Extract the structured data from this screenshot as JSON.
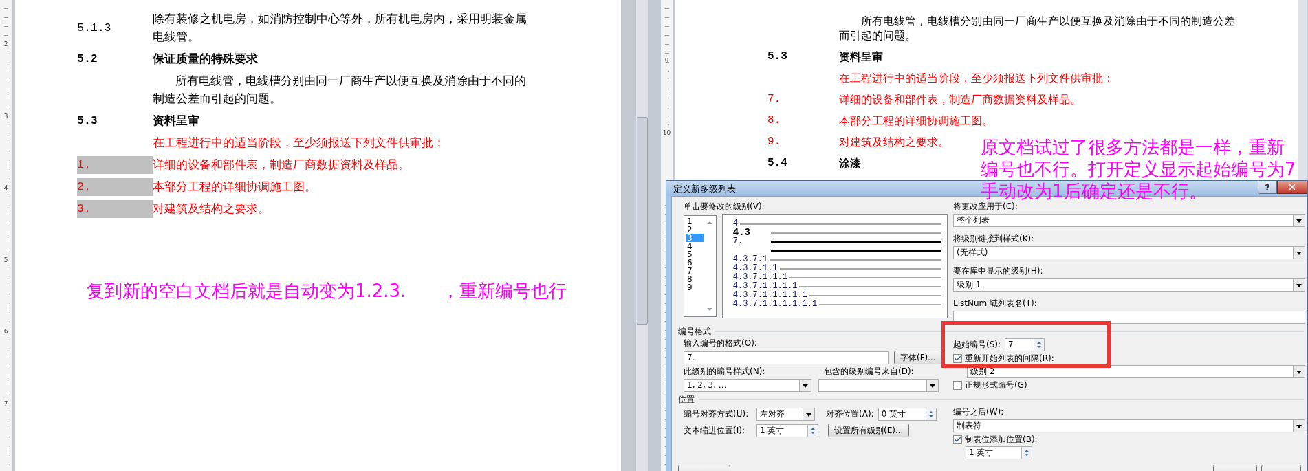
{
  "left_document": {
    "ruler": [
      "2",
      "3",
      "4",
      "5",
      "6",
      "7"
    ],
    "blocks": [
      {
        "kind": "clause",
        "number": "5.1.3",
        "text": "除有装修之机电房，如消防控制中心等外，所有机电房内，采用明装金属电线管。"
      },
      {
        "kind": "heading",
        "number": "5.2",
        "text": "保证质量的特殊要求"
      },
      {
        "kind": "paragraph",
        "text": "所有电线管，电线槽分别由同一厂商生产以便互换及消除由于不同的制造公差而引起的问题。"
      },
      {
        "kind": "heading",
        "number": "5.3",
        "text": "资料呈审"
      },
      {
        "kind": "red_line",
        "text": "在工程进行中的适当阶段，至少须报送下列文件供审批："
      },
      {
        "kind": "list_item",
        "number": "1.",
        "text": "详细的设备和部件表，制造厂商数据资料及样品。",
        "highlighted": true
      },
      {
        "kind": "list_item",
        "number": "2.",
        "text": "本部分工程的详细协调施工图。",
        "highlighted": true
      },
      {
        "kind": "list_item",
        "number": "3.",
        "text": "对建筑及结构之要求。",
        "highlighted": true
      }
    ],
    "note": "复到新的空白文档后就是自动变为1.2.3.　　，重新编号也行"
  },
  "right_document": {
    "ruler": [
      "9",
      "10"
    ],
    "blocks": [
      {
        "kind": "paragraph",
        "text": "所有电线管，电线槽分别由同一厂商生产以便互换及消除由于不同的制造公差而引起的问题。"
      },
      {
        "kind": "heading",
        "number": "5.3",
        "text": "资料呈审"
      },
      {
        "kind": "red_line",
        "text": "在工程进行中的适当阶段，至少须报送下列文件供审批："
      },
      {
        "kind": "list_item",
        "number": "7.",
        "text": "详细的设备和部件表，制造厂商数据资料及样品。",
        "highlighted": false
      },
      {
        "kind": "list_item",
        "number": "8.",
        "text": "本部分工程的详细协调施工图。",
        "highlighted": false
      },
      {
        "kind": "list_item",
        "number": "9.",
        "text": "对建筑及结构之要求。",
        "highlighted": false
      },
      {
        "kind": "heading",
        "number": "5.4",
        "text": "涂漆"
      }
    ]
  },
  "annotation": [
    "原文档试过了很多方法都是一样，重新",
    "编号也不行。打开定义显示起始编号为7",
    "手动改为1后确定还是不行。"
  ],
  "dialog": {
    "title": "定义新多级列表",
    "help_button": "?",
    "level_list": {
      "label": "单击要修改的级别(V):",
      "items": [
        {
          "label": "1",
          "selected": false
        },
        {
          "label": "2",
          "selected": false
        },
        {
          "label": "3",
          "selected": true
        },
        {
          "label": "4",
          "selected": false
        },
        {
          "label": "5",
          "selected": false
        },
        {
          "label": "6",
          "selected": false
        },
        {
          "label": "7",
          "selected": false
        },
        {
          "label": "8",
          "selected": false
        },
        {
          "label": "9",
          "selected": false
        }
      ]
    },
    "preview": {
      "rows": [
        {
          "label": "4",
          "kind": "plain",
          "bold": false
        },
        {
          "label": "4.3",
          "kind": "tabbed",
          "bold": true
        },
        {
          "label": "7.",
          "kind": "current",
          "bold": false
        },
        {
          "kind": "current"
        },
        {
          "label": "4.3.7.1",
          "kind": "plain",
          "bold": false
        },
        {
          "label": "4.3.7.1.1",
          "kind": "plain",
          "bold": false
        },
        {
          "label": "4.3.7.1.1.1",
          "kind": "plain",
          "bold": false
        },
        {
          "label": "4.3.7.1.1.1.1",
          "kind": "plain",
          "bold": false
        },
        {
          "label": "4.3.7.1.1.1.1.1",
          "kind": "plain",
          "bold": false
        },
        {
          "label": "4.3.7.1.1.1.1.1.1",
          "kind": "plain",
          "bold": false
        }
      ]
    },
    "apply_to": {
      "label": "将更改应用于(C):",
      "value": "整个列表"
    },
    "link_style": {
      "label": "将级别链接到样式(K):",
      "value": "(无样式)"
    },
    "gallery_level": {
      "label": "要在库中显示的级别(H):",
      "value": "级别 1"
    },
    "listnum": {
      "label": "ListNum 域列表名(T):"
    },
    "number_format": {
      "title": "编号格式",
      "format_label": "输入编号的格式(O):",
      "format_value": "7.",
      "font_button": "字体(F)...",
      "style_label": "此级别的编号样式(N):",
      "style_value": "1, 2, 3, …",
      "include_label": "包含的级别编号来自(D):"
    },
    "start_at": {
      "label": "起始编号(S):",
      "value": "7"
    },
    "restart": {
      "label": "重新开始列表的间隔(R):",
      "checked": true,
      "value": "级别 2"
    },
    "legal": {
      "label": "正规形式编号(G)",
      "checked": false
    },
    "position": {
      "title": "位置",
      "alignment_label": "编号对齐方式(U):",
      "alignment_value": "左对齐",
      "aligned_at_label": "对齐位置(A):",
      "aligned_at_value": "0 英寸",
      "indent_label": "文本缩进位置(I):",
      "indent_value": "1 英寸",
      "set_all_button": "设置所有级别(E)..."
    },
    "follow": {
      "label": "编号之后(W):",
      "value": "制表符"
    },
    "tab_stop": {
      "label": "制表位添加位置(B):",
      "checked": true,
      "value": "1 英寸"
    }
  }
}
